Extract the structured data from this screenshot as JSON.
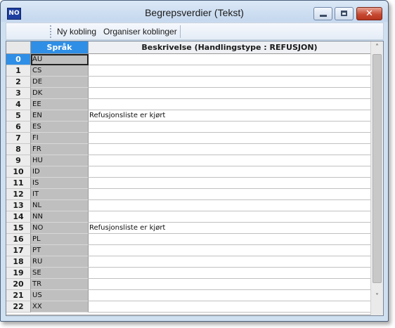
{
  "window": {
    "app_icon_text": "NO",
    "title": "Begrepsverdier (Tekst)",
    "close_glyph": "✕"
  },
  "toolbar": {
    "new_link_label": "Ny kobling",
    "organize_links_label": "Organiser koblinger"
  },
  "grid": {
    "columns": {
      "language": "Språk",
      "description": "Beskrivelse (Handlingstype : REFUSJON)"
    },
    "selected_row": 0,
    "rows": [
      {
        "num": "0",
        "lang": "AU",
        "desc": ""
      },
      {
        "num": "1",
        "lang": "CS",
        "desc": ""
      },
      {
        "num": "2",
        "lang": "DE",
        "desc": ""
      },
      {
        "num": "3",
        "lang": "DK",
        "desc": ""
      },
      {
        "num": "4",
        "lang": "EE",
        "desc": ""
      },
      {
        "num": "5",
        "lang": "EN",
        "desc": "Refusjonsliste er kjørt"
      },
      {
        "num": "6",
        "lang": "ES",
        "desc": ""
      },
      {
        "num": "7",
        "lang": "FI",
        "desc": ""
      },
      {
        "num": "8",
        "lang": "FR",
        "desc": ""
      },
      {
        "num": "9",
        "lang": "HU",
        "desc": ""
      },
      {
        "num": "10",
        "lang": "ID",
        "desc": ""
      },
      {
        "num": "11",
        "lang": "IS",
        "desc": ""
      },
      {
        "num": "12",
        "lang": "IT",
        "desc": ""
      },
      {
        "num": "13",
        "lang": "NL",
        "desc": ""
      },
      {
        "num": "14",
        "lang": "NN",
        "desc": ""
      },
      {
        "num": "15",
        "lang": "NO",
        "desc": "Refusjonsliste er kjørt"
      },
      {
        "num": "16",
        "lang": "PL",
        "desc": ""
      },
      {
        "num": "17",
        "lang": "PT",
        "desc": ""
      },
      {
        "num": "18",
        "lang": "RU",
        "desc": ""
      },
      {
        "num": "19",
        "lang": "SE",
        "desc": ""
      },
      {
        "num": "20",
        "lang": "TR",
        "desc": ""
      },
      {
        "num": "21",
        "lang": "US",
        "desc": ""
      },
      {
        "num": "22",
        "lang": "XX",
        "desc": ""
      }
    ]
  },
  "scrollbar": {
    "up_icon": "˄",
    "down_icon": "˅"
  },
  "colors": {
    "selection_blue": "#2f8fe6",
    "language_column": "#bfbfbf"
  }
}
